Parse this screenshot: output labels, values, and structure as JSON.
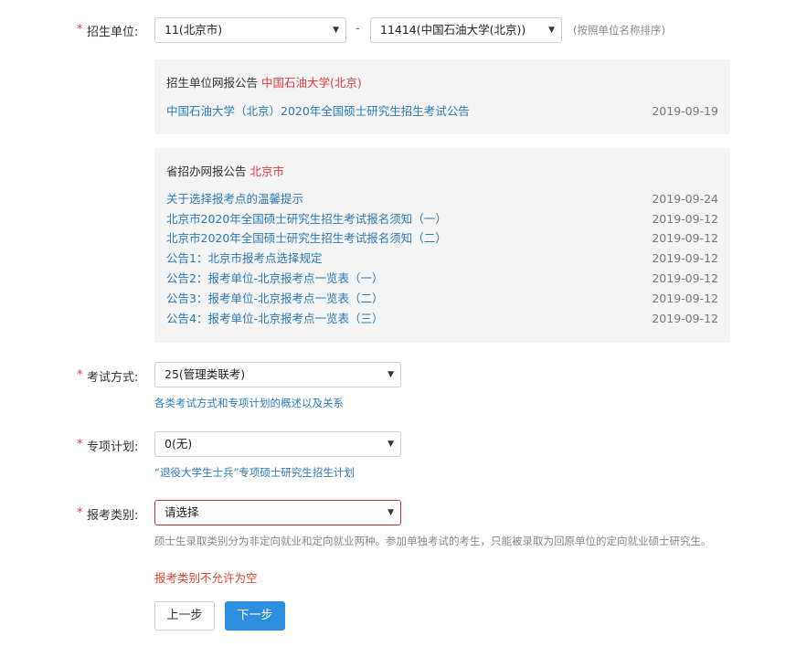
{
  "unit": {
    "label": "招生单位:",
    "province_value": "11(北京市)",
    "dash": "-",
    "school_value": "11414(中国石油大学(北京))",
    "hint": "(按照单位名称排序)"
  },
  "school_notice": {
    "title_prefix": "招生单位网报公告",
    "title_name": "中国石油大学(北京)",
    "items": [
      {
        "title": "中国石油大学（北京）2020年全国硕士研究生招生考试公告",
        "date": "2019-09-19"
      }
    ]
  },
  "province_notice": {
    "title_prefix": "省招办网报公告",
    "title_name": "北京市",
    "items": [
      {
        "title": "关于选择报考点的温馨提示",
        "date": "2019-09-24"
      },
      {
        "title": "北京市2020年全国硕士研究生招生考试报名须知（一）",
        "date": "2019-09-12"
      },
      {
        "title": "北京市2020年全国硕士研究生招生考试报名须知（二）",
        "date": "2019-09-12"
      },
      {
        "title": "公告1：北京市报考点选择规定",
        "date": "2019-09-12"
      },
      {
        "title": "公告2：报考单位-北京报考点一览表（一）",
        "date": "2019-09-12"
      },
      {
        "title": "公告3：报考单位-北京报考点一览表（二）",
        "date": "2019-09-12"
      },
      {
        "title": "公告4：报考单位-北京报考点一览表（三）",
        "date": "2019-09-12"
      }
    ]
  },
  "exam_mode": {
    "label": "考试方式:",
    "value": "25(管理类联考)",
    "link": "各类考试方式和专项计划的概述以及关系"
  },
  "special_plan": {
    "label": "专项计划:",
    "value": "0(无)",
    "link": "“退役大学生士兵”专项硕士研究生招生计划"
  },
  "category": {
    "label": "报考类别:",
    "value": "请选择",
    "desc": "硕士生录取类别分为非定向就业和定向就业两种。参加单独考试的考生，只能被录取为回原单位的定向就业硕士研究生。",
    "error": "报考类别不允许为空"
  },
  "buttons": {
    "prev": "上一步",
    "next": "下一步"
  },
  "required_mark": "*",
  "colors": {
    "accent": "#2d8ee0",
    "link": "#2a7ab7",
    "required": "#e53935",
    "error": "#d9452e",
    "panel_bg": "#f4f4f4"
  }
}
